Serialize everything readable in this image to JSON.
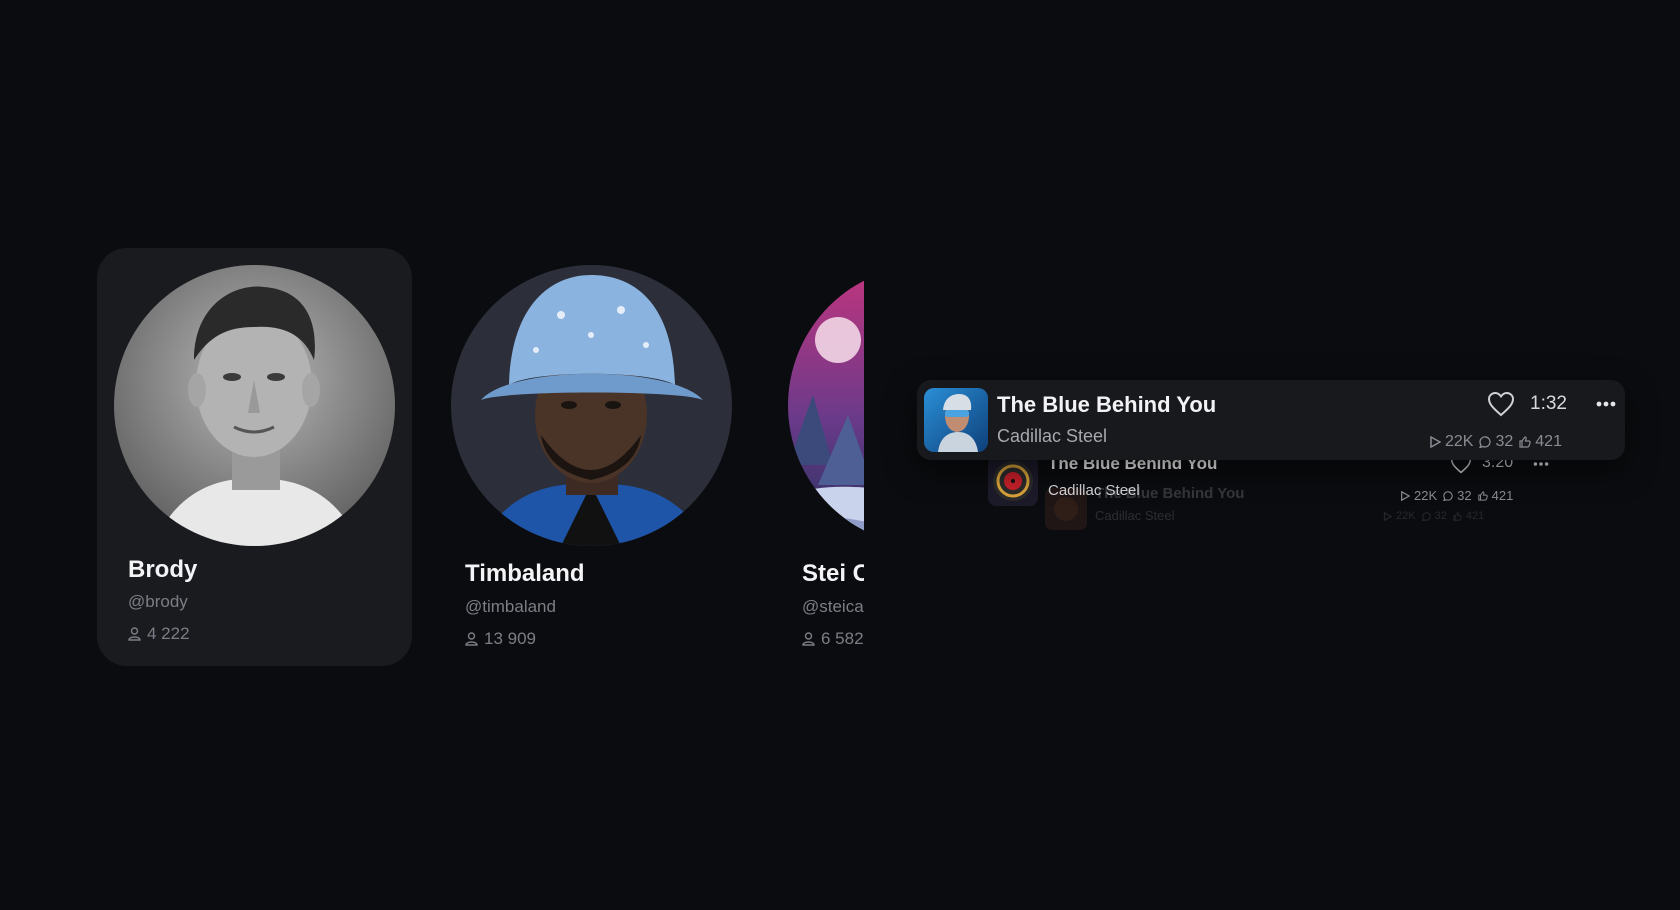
{
  "artists": [
    {
      "name": "Brody",
      "handle": "@brody",
      "followers": "4 222",
      "active": true
    },
    {
      "name": "Timbaland",
      "handle": "@timbaland",
      "followers": "13 909",
      "active": false
    },
    {
      "name": "Stei C",
      "handle": "@steica",
      "followers": "6 582",
      "active": false
    }
  ],
  "tracks": [
    {
      "title": "The Blue Behind You",
      "artist": "Cadillac Steel",
      "duration": "1:32",
      "plays": "22K",
      "comments": "32",
      "likes": "421"
    },
    {
      "title": "The Blue Behind You",
      "artist": "Cadillac Steel",
      "duration": "3:20",
      "plays": "22K",
      "comments": "32",
      "likes": "421"
    },
    {
      "title": "The Blue Behind You",
      "artist": "Cadillac Steel",
      "plays": "22K",
      "comments": "32",
      "likes": "421"
    }
  ],
  "icons": {
    "followers": "person-icon",
    "like": "heart-icon",
    "more": "more-dots-icon",
    "plays": "play-icon",
    "comments": "comment-icon",
    "likes": "thumbs-up-icon"
  },
  "colors": {
    "background": "#0b0c0f",
    "card": "#1a1b1f",
    "muted_text": "#7b7e86"
  }
}
